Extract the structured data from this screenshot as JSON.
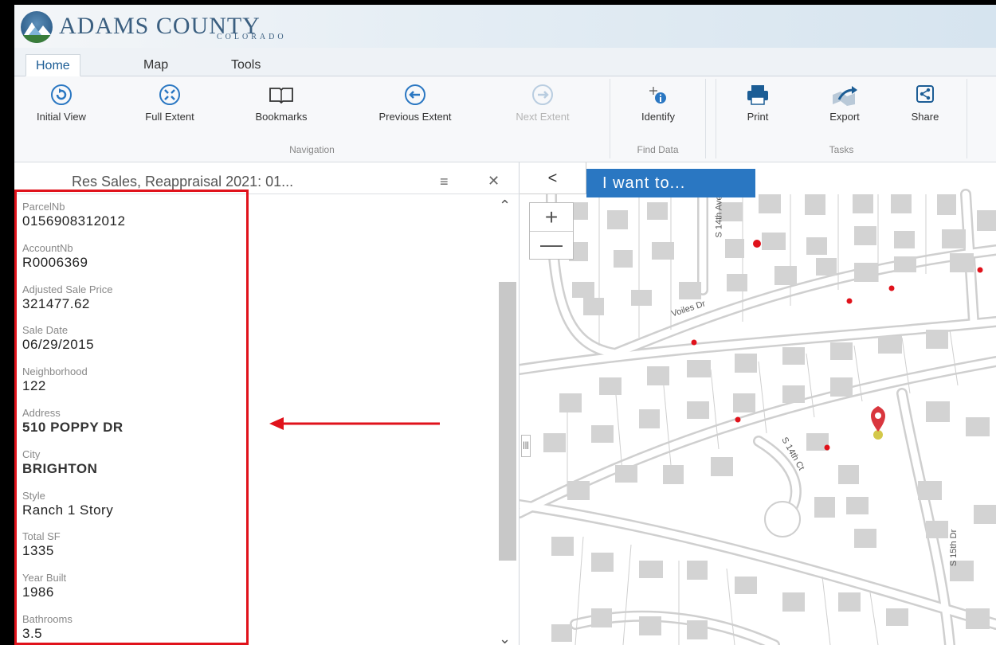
{
  "brand": {
    "title": "ADAMS COUNTY",
    "subtitle": "COLORADO"
  },
  "tabs": [
    {
      "label": "Home",
      "active": true
    },
    {
      "label": "Map",
      "active": false
    },
    {
      "label": "Tools",
      "active": false
    }
  ],
  "ribbon": {
    "navigation": {
      "label": "Navigation",
      "buttons": [
        {
          "label": "Initial View",
          "icon": "initial-view-icon"
        },
        {
          "label": "Full Extent",
          "icon": "full-extent-icon"
        },
        {
          "label": "Bookmarks",
          "icon": "bookmarks-icon"
        },
        {
          "label": "Previous Extent",
          "icon": "previous-extent-icon"
        },
        {
          "label": "Next Extent",
          "icon": "next-extent-icon",
          "disabled": true
        }
      ]
    },
    "find_data": {
      "label": "Find Data",
      "buttons": [
        {
          "label": "Identify",
          "icon": "identify-icon"
        }
      ]
    },
    "tasks": {
      "label": "Tasks",
      "buttons": [
        {
          "label": "Print",
          "icon": "print-icon"
        },
        {
          "label": "Export",
          "icon": "export-icon"
        },
        {
          "label": "Share",
          "icon": "share-icon"
        }
      ]
    }
  },
  "panel": {
    "title": "Res Sales, Reappraisal 2021: 01...",
    "fields": [
      {
        "label": "ParcelNb",
        "value": "0156908312012"
      },
      {
        "label": "AccountNb",
        "value": "R0006369"
      },
      {
        "label": "Adjusted Sale Price",
        "value": "321477.62"
      },
      {
        "label": "Sale Date",
        "value": "06/29/2015"
      },
      {
        "label": "Neighborhood",
        "value": "122"
      },
      {
        "label": "Address",
        "value": "510 POPPY DR"
      },
      {
        "label": "City",
        "value": "BRIGHTON"
      },
      {
        "label": "Style",
        "value": "Ranch 1 Story"
      },
      {
        "label": "Total SF",
        "value": "1335"
      },
      {
        "label": "Year Built",
        "value": "1986"
      },
      {
        "label": "Bathrooms",
        "value": "3.5"
      }
    ]
  },
  "map": {
    "back_label": "<",
    "iwant_label": "I want to...",
    "zoom_in": "+",
    "zoom_out": "—",
    "streets": [
      "S 14th Ave",
      "Voiles Dr",
      "S 14th Ct",
      "S 15th Dr"
    ]
  },
  "colors": {
    "accent": "#2a77c2",
    "highlight": "#e0121b",
    "marker": "#d9363e"
  }
}
